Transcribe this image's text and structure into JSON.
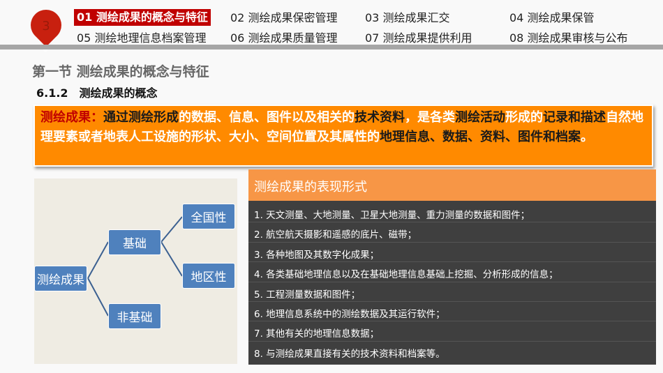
{
  "chapter_number": "3",
  "nav": [
    {
      "label": "01 测绘成果的概念与特征",
      "active": true
    },
    {
      "label": "02 测绘成果保密管理"
    },
    {
      "label": "03 测绘成果汇交"
    },
    {
      "label": "04 测绘成果保管"
    },
    {
      "label": "05 测绘地理信息档案管理"
    },
    {
      "label": "06 测绘成果质量管理"
    },
    {
      "label": "07 测绘成果提供利用"
    },
    {
      "label": "08 测绘成果审核与公布"
    }
  ],
  "section_title": "第一节 测绘成果的概念与特征",
  "subsection_title": "6.1.2　测绘成果的概念",
  "definition": [
    {
      "t": "测绘成果：",
      "c": "r"
    },
    {
      "t": "通过测绘形成",
      "c": "d"
    },
    {
      "t": "的数据、信息、图件以及相关的",
      "c": "w"
    },
    {
      "t": "技术资料",
      "c": "d"
    },
    {
      "t": "，是各类",
      "c": "w"
    },
    {
      "t": "测绘活动",
      "c": "d"
    },
    {
      "t": "形成的",
      "c": "w"
    },
    {
      "t": "记录和描述",
      "c": "d"
    },
    {
      "t": "自然地理要素或者地表人工设施的形状、大小、空间位置及其属性的",
      "c": "w"
    },
    {
      "t": "地理信息、数据、资料、图件和档案",
      "c": "d"
    },
    {
      "t": "。",
      "c": "w"
    }
  ],
  "diagram": {
    "root": "测绘成果",
    "basic": "基础",
    "non_basic": "非基础",
    "national": "全国性",
    "regional": "地区性"
  },
  "panel": {
    "title": "测绘成果的表现形式",
    "items": [
      "1. 天文测量、大地测量、卫星大地测量、重力测量的数据和图件；",
      "2. 航空航天摄影和遥感的底片、磁带；",
      "3. 各种地图及其数字化成果；",
      "4. 各类基础地理信息以及在基础地理信息基础上挖掘、分析形成的信息；",
      "5. 工程测量数据和图件；",
      "6. 地理信息系统中的测绘数据及其运行软件；",
      "7. 其他有关的地理信息数据；",
      "8. 与测绘成果直接有关的技术资料和档案等。"
    ]
  }
}
